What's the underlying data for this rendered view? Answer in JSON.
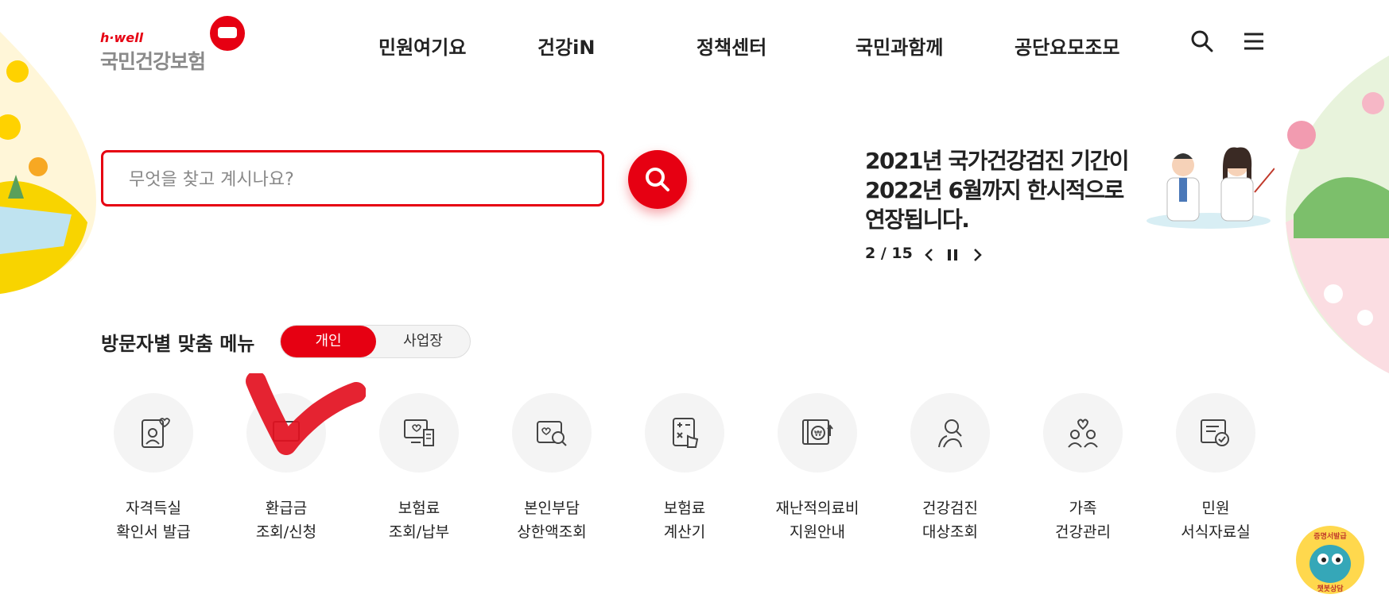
{
  "logo": {
    "brand_small": "h·well",
    "brand_name": "국민건강보험"
  },
  "nav": {
    "items": [
      {
        "label": "민원여기요"
      },
      {
        "label": "건강iN"
      },
      {
        "label": "정책센터"
      },
      {
        "label": "국민과함께"
      },
      {
        "label": "공단요모조모"
      }
    ]
  },
  "search": {
    "placeholder": "무엇을 찾고 계시나요?"
  },
  "notice": {
    "line1": "2021년 국가건강검진 기간이",
    "line2": "2022년 6월까지 한시적으로",
    "line3": "연장됩니다.",
    "pager": "2 / 15"
  },
  "menu": {
    "title": "방문자별 맞춤 메뉴",
    "toggle_on": "개인",
    "toggle_off": "사업장",
    "items": [
      {
        "line1": "자격득실",
        "line2": "확인서 발급",
        "icon": "id-card-heart-icon"
      },
      {
        "line1": "환급금",
        "line2": "조회/신청",
        "icon": "refund-icon"
      },
      {
        "line1": "보험료",
        "line2": "조회/납부",
        "icon": "monitor-receipt-icon"
      },
      {
        "line1": "본인부담",
        "line2": "상한액조회",
        "icon": "search-heart-icon"
      },
      {
        "line1": "보험료",
        "line2": "계산기",
        "icon": "calculator-icon"
      },
      {
        "line1": "재난적의료비",
        "line2": "지원안내",
        "icon": "won-support-icon"
      },
      {
        "line1": "건강검진",
        "line2": "대상조회",
        "icon": "people-search-icon"
      },
      {
        "line1": "가족",
        "line2": "건강관리",
        "icon": "family-heart-icon"
      },
      {
        "line1": "민원",
        "line2": "서식자료실",
        "icon": "document-check-icon"
      }
    ]
  },
  "chatbot": {
    "label_top": "증명서발급",
    "label_bottom": "챗봇상담"
  },
  "colors": {
    "accent": "#e60012",
    "circle_bg": "#f4f4f4"
  }
}
